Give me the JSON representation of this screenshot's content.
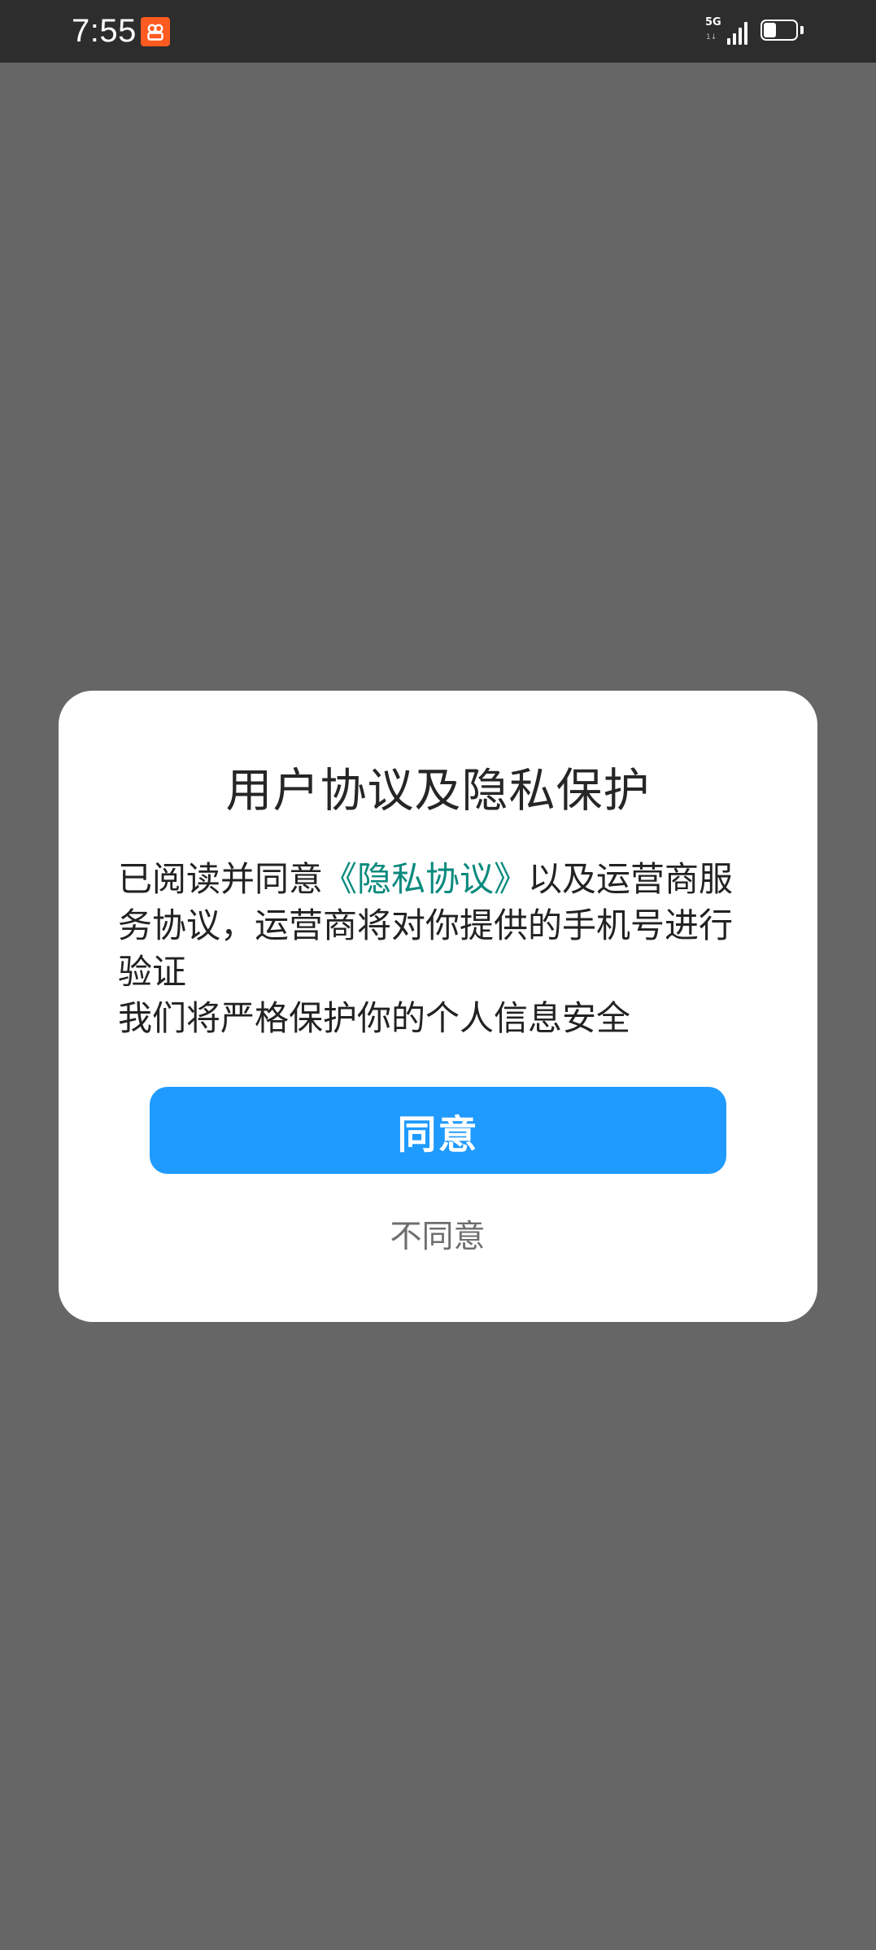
{
  "status_bar": {
    "time": "7:55",
    "network_label": "5G",
    "network_sub": "1↓",
    "signal_level": 4,
    "battery_level": 0.4
  },
  "dialog": {
    "title": "用户协议及隐私保护",
    "body": {
      "intro": "已阅读并同意",
      "privacy_link": "《隐私协议》",
      "middle": "以及运营商服务协议，运营商将对你提供的手机号进行验证",
      "closing": "我们将严格保护你的个人信息安全"
    },
    "agree_label": "同意",
    "disagree_label": "不同意"
  },
  "colors": {
    "overlay": "#666666",
    "status_bar": "#2d2d2d",
    "primary_button": "#1f9bff",
    "link": "#0a8a7e",
    "app_icon": "#ff5a1f"
  },
  "icons": {
    "app": "app-notification-icon",
    "signal": "signal-icon",
    "battery": "battery-icon"
  }
}
